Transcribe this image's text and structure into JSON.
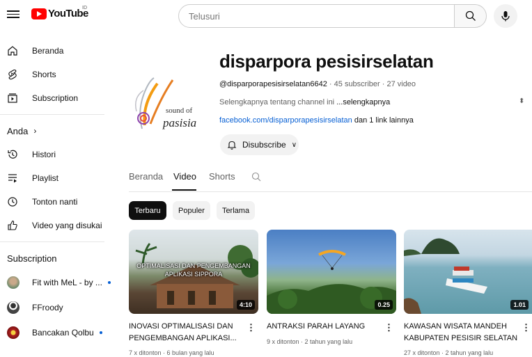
{
  "header": {
    "logo_text": "YouTube",
    "logo_country": "ID",
    "search_placeholder": "Telusuri"
  },
  "sidebar": {
    "main": [
      {
        "label": "Beranda",
        "icon": "home-icon"
      },
      {
        "label": "Shorts",
        "icon": "shorts-icon"
      },
      {
        "label": "Subscription",
        "icon": "subscriptions-icon"
      }
    ],
    "you_heading": "Anda",
    "you_items": [
      {
        "label": "Histori",
        "icon": "history-icon"
      },
      {
        "label": "Playlist",
        "icon": "playlist-icon"
      },
      {
        "label": "Tonton nanti",
        "icon": "clock-icon"
      },
      {
        "label": "Video yang disukai",
        "icon": "thumbs-up-icon"
      }
    ],
    "subs_heading": "Subscription",
    "subs": [
      {
        "label": "Fit with MeL - by ...",
        "color": "#8a9a8a",
        "new": true
      },
      {
        "label": "FFroody",
        "color": "#555555",
        "new": false
      },
      {
        "label": "Bancakan Qolbu",
        "color": "#b22222",
        "new": true
      }
    ]
  },
  "channel": {
    "name": "disparpora pesisirselatan",
    "handle": "@disparporapesisirselatan6642",
    "stats": " · 45 subscriber · 27 video",
    "desc_prefix": "Selengkapnya tentang channel ini ",
    "desc_more": "...selengkapnya",
    "link": "facebook.com/disparporapesisirselatan",
    "link_suffix": " dan 1 link lainnya",
    "subscribe_label": "Disubscribe",
    "logo_line1": "sound of",
    "logo_line2": "pasisia"
  },
  "tabs": [
    "Beranda",
    "Video",
    "Shorts"
  ],
  "chips": [
    "Terbaru",
    "Populer",
    "Terlama"
  ],
  "videos": [
    {
      "title1": "INOVASI OPTIMALISASI DAN",
      "title2": "PENGEMBANGAN APLIKASI...",
      "meta": "7 x ditonton · 6 bulan yang lalu",
      "duration": "4:10",
      "caption": "OPTIMALISASI DAN PENGEMBANGAN APLIKASI SIPPORA"
    },
    {
      "title1": "ANTRAKSI PARAH LAYANG",
      "title2": "",
      "meta": "9 x ditonton · 2 tahun yang lalu",
      "duration": "0.25",
      "caption": ""
    },
    {
      "title1": "KAWASAN WISATA MANDEH",
      "title2": "KABUPATEN PESISIR SELATAN",
      "meta": "27 x ditonton · 2 tahun yang lalu",
      "duration": "1.01",
      "caption": ""
    }
  ]
}
